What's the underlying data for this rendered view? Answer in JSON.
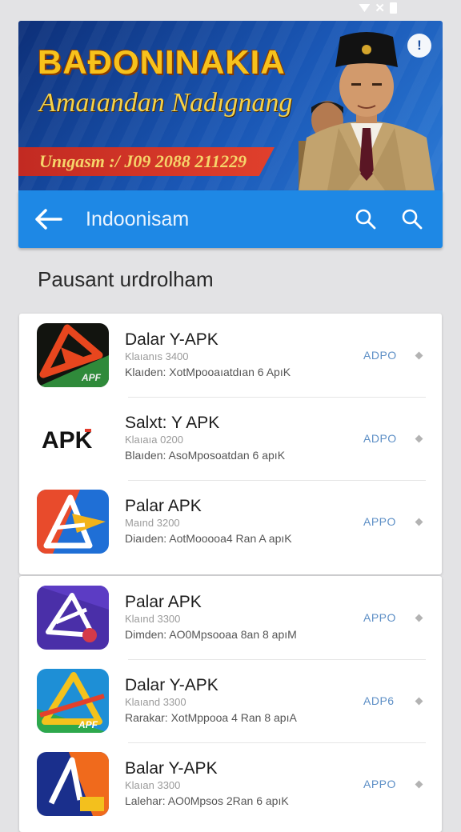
{
  "banner": {
    "title": "BAÐONINAKIA",
    "subtitle": "Amaıandan Nadıgnang",
    "ribbon_text": "Unıgasm :/ J09 2088 211229",
    "info_label": "!"
  },
  "toolbar": {
    "title": "Indoonisam"
  },
  "section": {
    "title": "Pausant urdrolham"
  },
  "apps": [
    {
      "name": "Dalar Y-APK",
      "version": "Klaıanıs 3400",
      "desc": "Klaıden:  XotMpooaıatdıan 6 ApıK",
      "tag": "ADPO",
      "icon_label": "APF"
    },
    {
      "name": "Salxt: Y APK",
      "version": "Klaıaıa 0200",
      "desc": "Blaıden:  AsoMposoatdan 6 apıK",
      "tag": "ADPO",
      "icon_label": "APK"
    },
    {
      "name": "Palar APK",
      "version": "Maınd 3200",
      "desc": "Diaıden:  AotMooooa4 Ran A apıK",
      "tag": "APPO",
      "icon_label": ""
    },
    {
      "name": "Palar APK",
      "version": "Klaınd 3300",
      "desc": "Dimden:  AO0Mpsooaa 8an 8 apıM",
      "tag": "APPO",
      "icon_label": ""
    },
    {
      "name": "Dalar Y-APK",
      "version": "Klaıand 3300",
      "desc": "Rarakar:  XotMppooa 4 Ran 8 apıA",
      "tag": "ADP6",
      "icon_label": "APF"
    },
    {
      "name": "Balar Y-APK",
      "version": "Klaıan 3300",
      "desc": "Lalehar:  AO0Mpsos 2Ran 6 apıK",
      "tag": "APPO",
      "icon_label": ""
    }
  ]
}
